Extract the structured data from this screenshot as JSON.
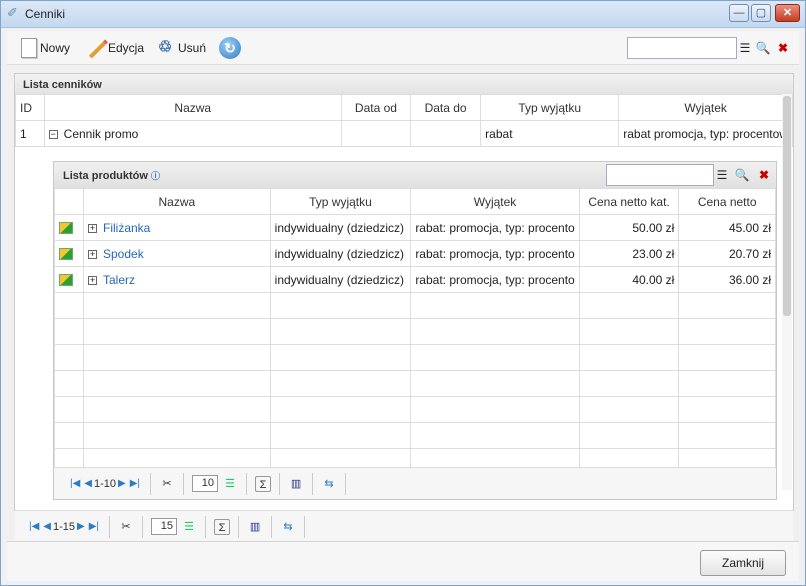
{
  "window": {
    "title": "Cenniki",
    "minimize": "—",
    "maximize": "▢",
    "close": "✕"
  },
  "toolbar": {
    "new_label": "Nowy",
    "edit_label": "Edycja",
    "delete_label": "Usuń"
  },
  "icons": {
    "title": "tag-icon",
    "search": "magnifier-icon",
    "filter": "filter-list-icon",
    "clear": "red-x-icon",
    "refresh": "refresh-icon",
    "product": "product-box-icon"
  },
  "price_lists": {
    "title": "Lista cenników",
    "columns": [
      "ID",
      "Nazwa",
      "Data od",
      "Data do",
      "Typ wyjątku",
      "Wyjątek"
    ],
    "rows": [
      {
        "id": "1",
        "name": "Cennik promo",
        "date_from": "",
        "date_to": "",
        "exception_type": "rabat",
        "exception": "rabat promocja, typ: procentow"
      }
    ],
    "pager": {
      "range": "1-15",
      "page_size": "15"
    }
  },
  "products": {
    "title": "Lista produktów",
    "info_icon": "ⓘ",
    "columns": [
      "Nazwa",
      "Typ wyjątku",
      "Wyjątek",
      "Cena netto kat.",
      "Cena netto"
    ],
    "rows": [
      {
        "name": "Filiżanka",
        "exception_type": "indywidualny (dziedzicz)",
        "exception": "rabat: promocja, typ: procento",
        "catalog_price": "50.00 zł",
        "net_price": "45.00 zł"
      },
      {
        "name": "Spodek",
        "exception_type": "indywidualny (dziedzicz)",
        "exception": "rabat: promocja, typ: procento",
        "catalog_price": "23.00 zł",
        "net_price": "20.70 zł"
      },
      {
        "name": "Talerz",
        "exception_type": "indywidualny (dziedzicz)",
        "exception": "rabat: promocja, typ: procento",
        "catalog_price": "40.00 zł",
        "net_price": "36.00 zł"
      }
    ],
    "pager": {
      "range": "1-10",
      "page_size": "10"
    }
  },
  "footer": {
    "close_label": "Zamknij"
  }
}
